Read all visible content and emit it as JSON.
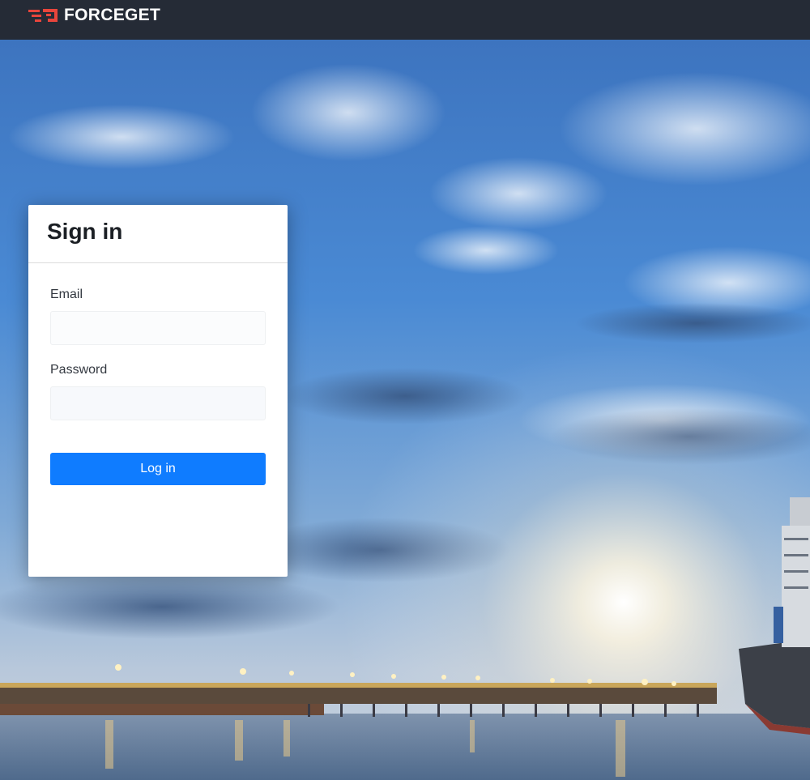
{
  "header": {
    "brand": "FORCEGET",
    "brand_color": "#e8453c",
    "background": "#252b36"
  },
  "signin": {
    "title": "Sign in",
    "email_label": "Email",
    "email_value": "",
    "password_label": "Password",
    "password_value": "",
    "login_label": "Log in",
    "accent_color": "#0f7cff"
  },
  "background": {
    "scene": "port-at-dusk",
    "sky_color": "#3f7cc8",
    "water_color": "#5f7c9c"
  }
}
